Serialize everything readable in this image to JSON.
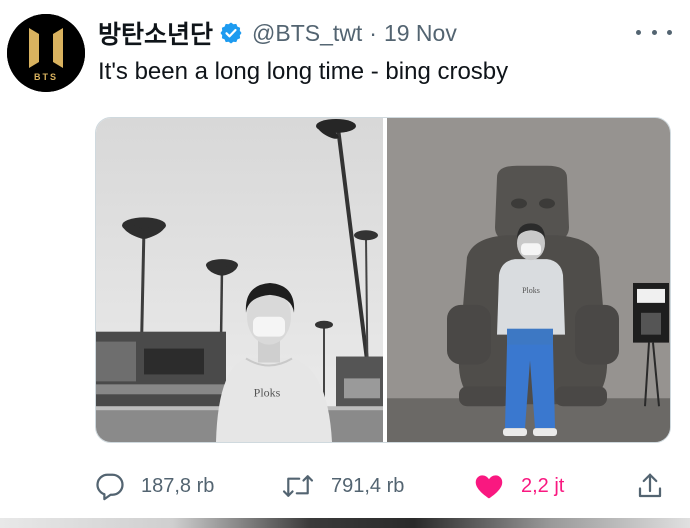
{
  "tweet": {
    "author_name": "방탄소년단",
    "handle": "@BTS_twt",
    "separator": "·",
    "date": "19 Nov",
    "text": "It's been a long long time - bing crosby",
    "avatar_logo_text": "BTS",
    "left_photo_shirt_text": "Ploks",
    "right_photo_shirt_text": "Ploks"
  },
  "actions": {
    "replies": "187,8 rb",
    "retweets": "791,4 rb",
    "likes": "2,2 jt"
  },
  "colors": {
    "text_primary": "#0f1419",
    "text_secondary": "#536471",
    "verified_blue": "#1d9bf0",
    "like_pink": "#f91880",
    "avatar_gold": "#d9b25f"
  },
  "icons": {
    "verified": "verified-badge-icon",
    "more": "more-icon",
    "reply": "reply-icon",
    "retweet": "retweet-icon",
    "like": "heart-icon",
    "share": "share-icon"
  }
}
